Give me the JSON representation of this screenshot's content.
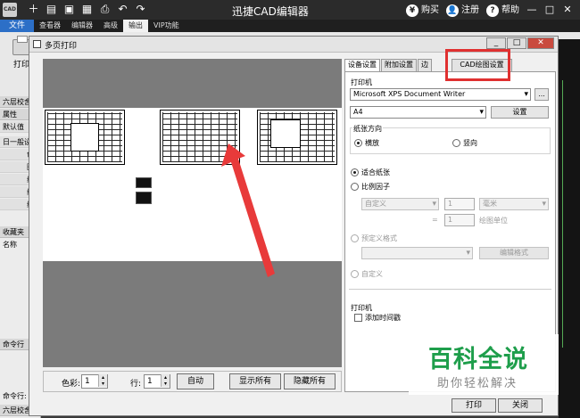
{
  "app": {
    "logo": "CAD",
    "title": "迅捷CAD编辑器"
  },
  "topbar": {
    "buy": "购买",
    "register": "注册",
    "help": "帮助",
    "buy_icon": "¥",
    "reg_icon": "👤",
    "help_icon": "?"
  },
  "menu": {
    "file": "文件",
    "items": [
      "查看器",
      "编辑器",
      "高级",
      "输出",
      "VIP功能"
    ]
  },
  "toolbar": {
    "print": "打印"
  },
  "left": {
    "p1": "六层校舍",
    "p2": "属性",
    "p3": "默认值",
    "p4": "日一般设",
    "p5": "色",
    "p6": "图",
    "p7": "线",
    "p8": "线",
    "p9": "线",
    "p10": "收藏夹",
    "p11": "名称",
    "p12": "命令行",
    "p13": "命令行:",
    "p14": "六层校舍"
  },
  "dialog": {
    "title": "多页打印",
    "tabs": [
      "设备设置",
      "附加设置",
      "边"
    ],
    "cad_tab": "CAD绘图设置",
    "printer_section": "打印机",
    "printer": "Microsoft XPS Document Writer",
    "more": "...",
    "paper": "A4",
    "settings": "设置",
    "orientation": "纸张方向",
    "landscape": "横放",
    "portrait": "竖向",
    "fit": "适合纸张",
    "scale": "比例因子",
    "custom": "自定义",
    "val1": "1",
    "unit": "毫米",
    "eq": "=",
    "val2": "1",
    "drawing_unit": "绘图单位",
    "preset": "预定义格式",
    "edit_format": "编辑格式",
    "custom2": "自定义",
    "printer2": "打印机",
    "timestamp": "添加时间戳",
    "color_label": "色彩:",
    "color_val": "1",
    "row_label": "行:",
    "row_val": "1",
    "auto": "自动",
    "show_all": "显示所有",
    "hide_all": "隐藏所有",
    "print_btn": "打印",
    "close_btn": "关闭",
    "min": "_",
    "max": "□",
    "close": "✕"
  },
  "watermark": {
    "line1": "百科全说",
    "line2": "助你轻松解决"
  },
  "colors": {
    "accent": "#2c6fc7",
    "highlight": "#e03030",
    "watermark": "#1e9e4b"
  }
}
